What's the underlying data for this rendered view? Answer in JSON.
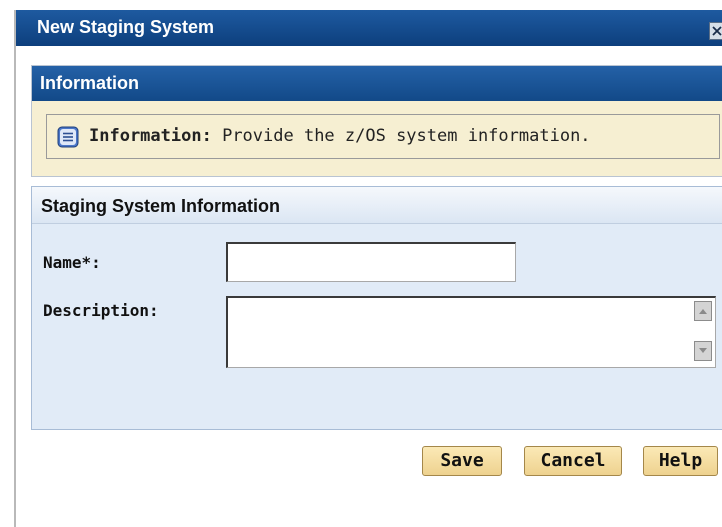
{
  "dialog": {
    "title": "New Staging System"
  },
  "info_panel": {
    "header": "Information",
    "message_label": "Information:",
    "message_text": "Provide the z/OS system information."
  },
  "system_panel": {
    "header": "Staging System Information",
    "name_label": "Name*:",
    "name_value": "",
    "description_label": "Description:",
    "description_value": ""
  },
  "buttons": {
    "save": "Save",
    "cancel": "Cancel",
    "help": "Help"
  },
  "icons": {
    "close": "close-icon",
    "info": "info-icon",
    "scroll_up": "scroll-up-icon",
    "scroll_down": "scroll-down-icon"
  }
}
